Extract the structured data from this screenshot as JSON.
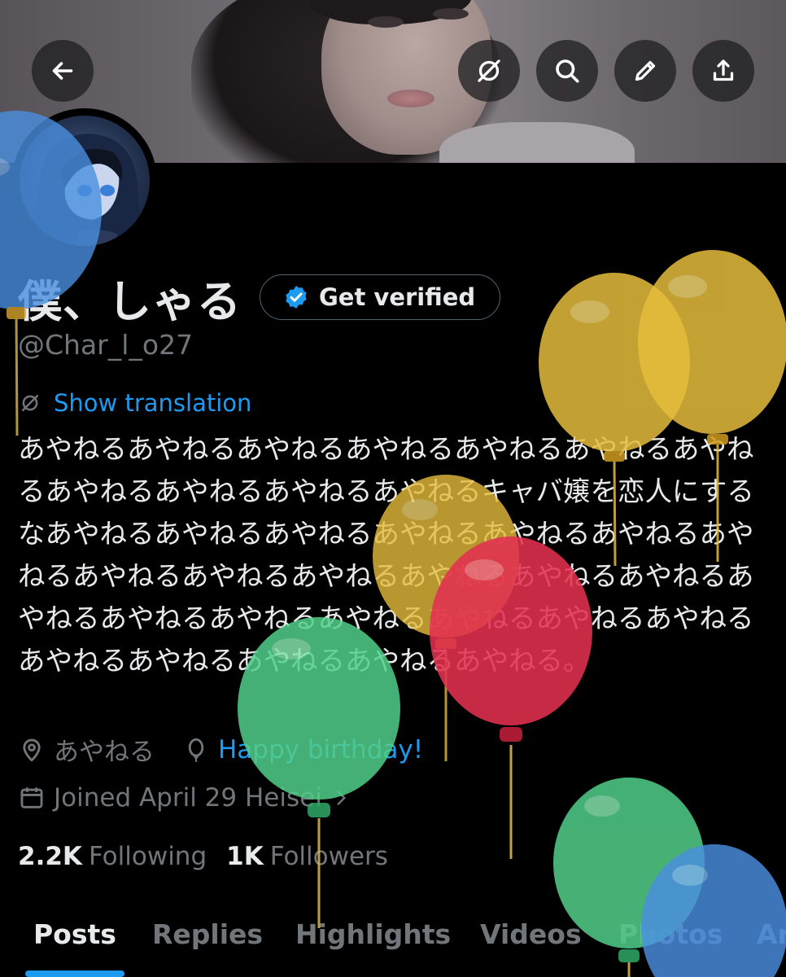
{
  "header": {
    "back_icon": "arrow-left-icon",
    "buttons": [
      "translate-off-icon",
      "search-icon",
      "pencil-icon",
      "share-icon"
    ]
  },
  "profile": {
    "display_name": "僕、しゃる",
    "verify_label": "Get verified",
    "handle": "@Char_l_o27",
    "translate_label": "Show translation",
    "bio": "あやねるあやねるあやねるあやねるあやねるあやねるあやねるあやねるあやねるあやねるあやねるキャバ嬢を恋人にするなあやねるあやねるあやねるあやねるあやねるあやねるあやねるあやねるあやねるあやねるあやねるあやねるあやねるあやねるあやねるあやねるあやねるあやねるあやねるあやねるあやねるあやねるあやねるあやねるあやねる。",
    "location": "あやねる",
    "birthday": "Happy birthday!",
    "joined": "Joined April 29 Heisei",
    "following_count": "2.2K",
    "following_label": "Following",
    "followers_count": "1K",
    "followers_label": "Followers"
  },
  "tabs": [
    "Posts",
    "Replies",
    "Highlights",
    "Videos",
    "Photos",
    "Ar"
  ],
  "colors": {
    "accent": "#1d9bf0",
    "muted": "#71767b",
    "text": "#e7e9ea",
    "background": "#000000"
  }
}
